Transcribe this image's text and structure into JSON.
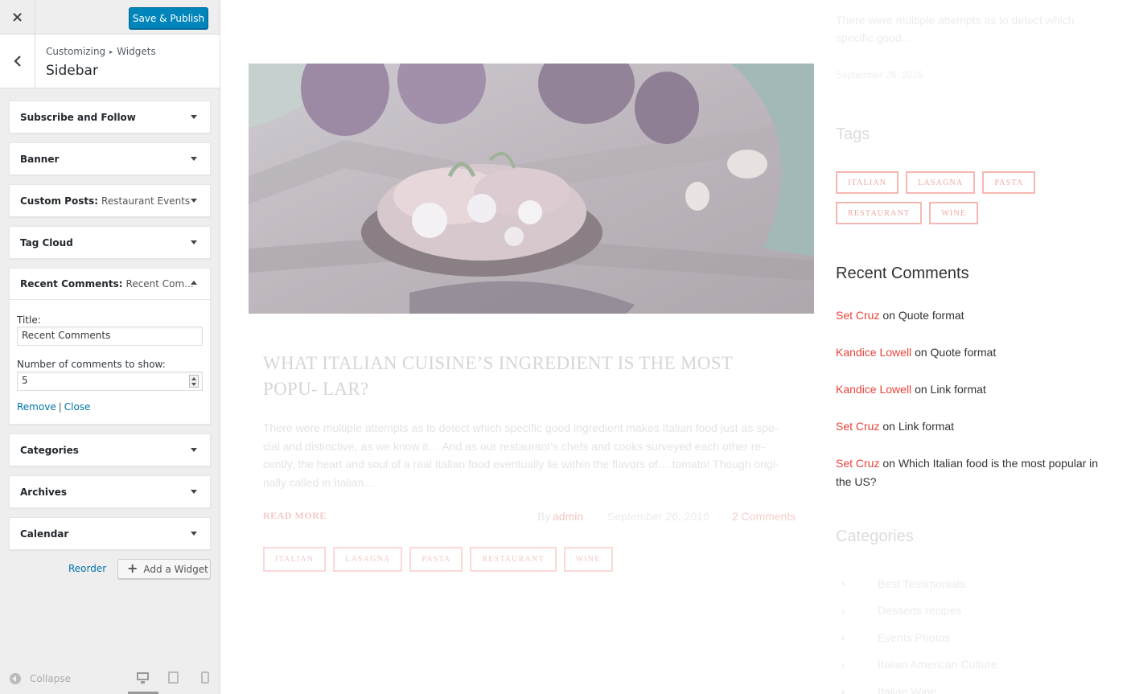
{
  "customizer": {
    "close_label": "×",
    "save_label": "Save & Publish",
    "breadcrumb": {
      "root": "Customizing",
      "separator": "▸",
      "current": "Widgets"
    },
    "section_title": "Sidebar",
    "widgets": [
      {
        "name": "Subscribe and Follow",
        "subtitle": ""
      },
      {
        "name": "Banner",
        "subtitle": ""
      },
      {
        "name": "Custom Posts:",
        "subtitle": "Restaurant Events"
      },
      {
        "name": "Tag Cloud",
        "subtitle": ""
      },
      {
        "name": "Recent Comments:",
        "subtitle": "Recent Com..."
      },
      {
        "name": "Categories",
        "subtitle": ""
      },
      {
        "name": "Archives",
        "subtitle": ""
      },
      {
        "name": "Calendar",
        "subtitle": ""
      }
    ],
    "open_widget": {
      "title_label": "Title:",
      "title_value": "Recent Comments",
      "count_label": "Number of comments to show:",
      "count_value": "5",
      "remove_label": "Remove",
      "pipe": "|",
      "close_label": "Close"
    },
    "reorder_label": "Reorder",
    "add_widget_label": "Add a Widget",
    "collapse_label": "Collapse",
    "colors": {
      "primary_button": "#0085ba",
      "link": "#0073aa",
      "panel_bg": "#eeeeee"
    }
  },
  "preview": {
    "top_excerpt": "There were multiple attempts as to detect which specific good...",
    "top_date": "September 26, 2016",
    "post": {
      "title": "WHAT ITALIAN CUISINE’S INGREDIENT IS THE MOST POPU- LAR?",
      "excerpt": "There were multiple attempts as to detect which specific good ingredient makes Italian food just as spe- cial and distinctive, as we know it… And as our restaurant’s chefs and cooks surveyed each other re- cently, the heart and soul of a real Italian food eventually lie within the flavors of… tomato! Though origi- nally called in Italian…",
      "read_more": "READ MORE",
      "by_label": "By",
      "author": "admin",
      "date": "September 26, 2016",
      "comments": "2 Comments",
      "tags": [
        "ITALIAN",
        "LASAGNA",
        "PASTA",
        "RESTAURANT",
        "WINE"
      ]
    },
    "tags_widget": {
      "title": "Tags",
      "tags": [
        "ITALIAN",
        "LASAGNA",
        "PASTA",
        "RESTAURANT",
        "WINE"
      ]
    },
    "recent_comments": {
      "title": "Recent Comments",
      "items": [
        {
          "author": "Set Cruz",
          "on": "on",
          "post": "Quote format"
        },
        {
          "author": "Kandice Lowell",
          "on": "on",
          "post": "Quote format"
        },
        {
          "author": "Kandice Lowell",
          "on": "on",
          "post": "Link format"
        },
        {
          "author": "Set Cruz",
          "on": "on",
          "post": "Link format"
        },
        {
          "author": "Set Cruz",
          "on": "on",
          "post": "Which Italian food is the most popular in the US?"
        }
      ]
    },
    "categories": {
      "title": "Categories",
      "items": [
        "Best Testimonials",
        "Desserts recipes",
        "Events Photos",
        "Italian American Culture",
        "Italian Wine"
      ]
    },
    "colors": {
      "accent": "#e8423a",
      "tag_border": "#f6b7b2"
    }
  }
}
